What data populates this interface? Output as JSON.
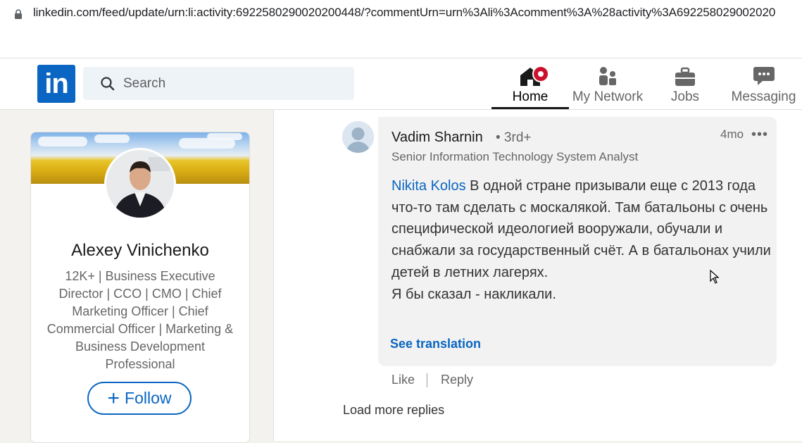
{
  "browser": {
    "url": "linkedin.com/feed/update/urn:li:activity:6922580290020200448/?commentUrn=urn%3Ali%3Acomment%3A%28activity%3A692258029002020"
  },
  "search": {
    "placeholder": "Search"
  },
  "nav": {
    "home": "Home",
    "network": "My Network",
    "jobs": "Jobs",
    "messaging": "Messaging"
  },
  "profile": {
    "name": "Alexey Vinichenko",
    "headline": "12K+ | Business Executive Director | CCO | CMO | Chief Marketing Officer | Chief Commercial Officer | Marketing & Business Development Professional",
    "follow_label": "Follow"
  },
  "comment": {
    "author": "Vadim Sharnin",
    "degree": "• 3rd+",
    "title": "Senior Information Technology System Analyst",
    "time": "4mo",
    "more": "•••",
    "mention": "Nikita Kolos",
    "text": " В одной стране призывали еще с 2013 года что-то там сделать с москалякой. Там батальоны с очень специфической идеологией вооружали, обучали и снабжали за государственный счёт. А в батальонах учили детей в летних лагерях.",
    "text2": "Я бы сказал - накликали.",
    "see_translation": "See translation",
    "like": "Like",
    "reply": "Reply"
  },
  "load_more": "Load more replies",
  "colors": {
    "brand": "#0a66c2",
    "notification": "#cb112d"
  }
}
